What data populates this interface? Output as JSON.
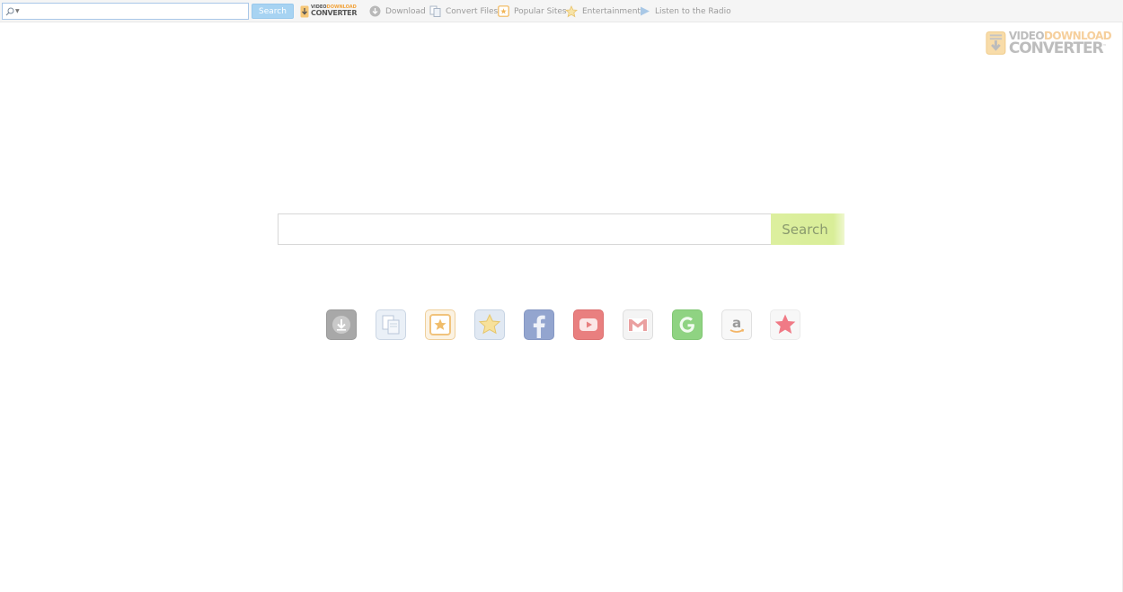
{
  "toolbar": {
    "search_placeholder": "",
    "search_label": "Search",
    "logo": {
      "line1_a": "VIDEO",
      "line1_b": "DOWNLOAD",
      "line2": "CONVERTER"
    },
    "items": [
      {
        "label": "Download",
        "icon": "download-icon"
      },
      {
        "label": "Convert Files",
        "icon": "convert-files-icon"
      },
      {
        "label": "Popular Sites",
        "icon": "popular-sites-icon"
      },
      {
        "label": "Entertainment",
        "icon": "star-icon"
      },
      {
        "label": "Listen to the Radio",
        "icon": "play-icon"
      }
    ]
  },
  "brand": {
    "line1_a": "VIDEO",
    "line1_b": "DOWNLOAD",
    "line2": "CONVERTER",
    "tm": "™"
  },
  "main": {
    "search_placeholder": "",
    "search_label": "Search"
  },
  "quick_links": [
    {
      "icon": "download-icon",
      "color": "#a5a5a5"
    },
    {
      "icon": "convert-files-icon",
      "color": "#d6e2f0"
    },
    {
      "icon": "popular-sites-icon",
      "color": "#f3cd92"
    },
    {
      "icon": "favorites-star-icon",
      "color": "#c9d6e8"
    },
    {
      "icon": "facebook-icon",
      "color": "#9aaad0"
    },
    {
      "icon": "youtube-icon",
      "color": "#e77e7e"
    },
    {
      "icon": "gmail-icon",
      "color": "#f0f0f0"
    },
    {
      "icon": "google-icon",
      "color": "#8ed17f"
    },
    {
      "icon": "amazon-icon",
      "color": "#f6f6f6"
    },
    {
      "icon": "bookmark-star-icon",
      "color": "#f7f7f7"
    }
  ],
  "colors": {
    "toolbar_button": "#a7d3f2",
    "main_button": "#dcef9f",
    "accent": "#f2a33b"
  }
}
